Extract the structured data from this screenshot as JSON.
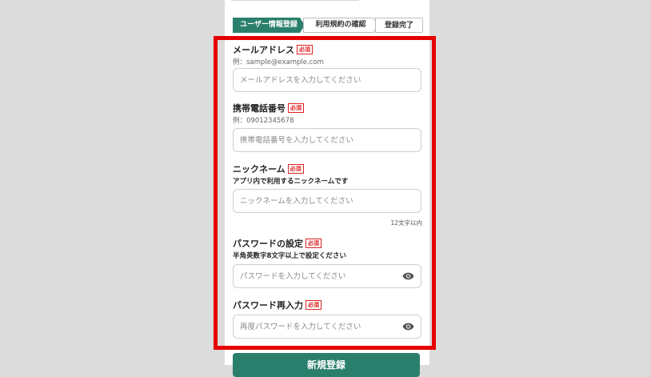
{
  "stepper": {
    "steps": [
      {
        "label": "ユーザー情報登録"
      },
      {
        "label": "利用規約の確認"
      },
      {
        "label": "登録完了"
      }
    ]
  },
  "form": {
    "required_badge": "必須",
    "email": {
      "label": "メールアドレス",
      "hint": "例：sample@example.com",
      "placeholder": "メールアドレスを入力してください"
    },
    "phone": {
      "label": "携帯電話番号",
      "hint": "例：09012345678",
      "placeholder": "携帯電話番号を入力してください"
    },
    "nickname": {
      "label": "ニックネーム",
      "hint": "アプリ内で利用するニックネームです",
      "placeholder": "ニックネームを入力してください",
      "counter": "12文字以内"
    },
    "password": {
      "label": "パスワードの設定",
      "hint": "半角英数字8文字以上で設定ください",
      "placeholder": "パスワードを入力してください",
      "icon": "eye-icon"
    },
    "password_confirm": {
      "label": "パスワード再入力",
      "placeholder": "再度パスワードを入力してください",
      "icon": "eye-icon"
    }
  },
  "submit_label": "新規登録",
  "colors": {
    "accent": "#2a7f6c",
    "required": "#dd2222",
    "highlight": "#e60000",
    "background": "#dcdcdc"
  }
}
